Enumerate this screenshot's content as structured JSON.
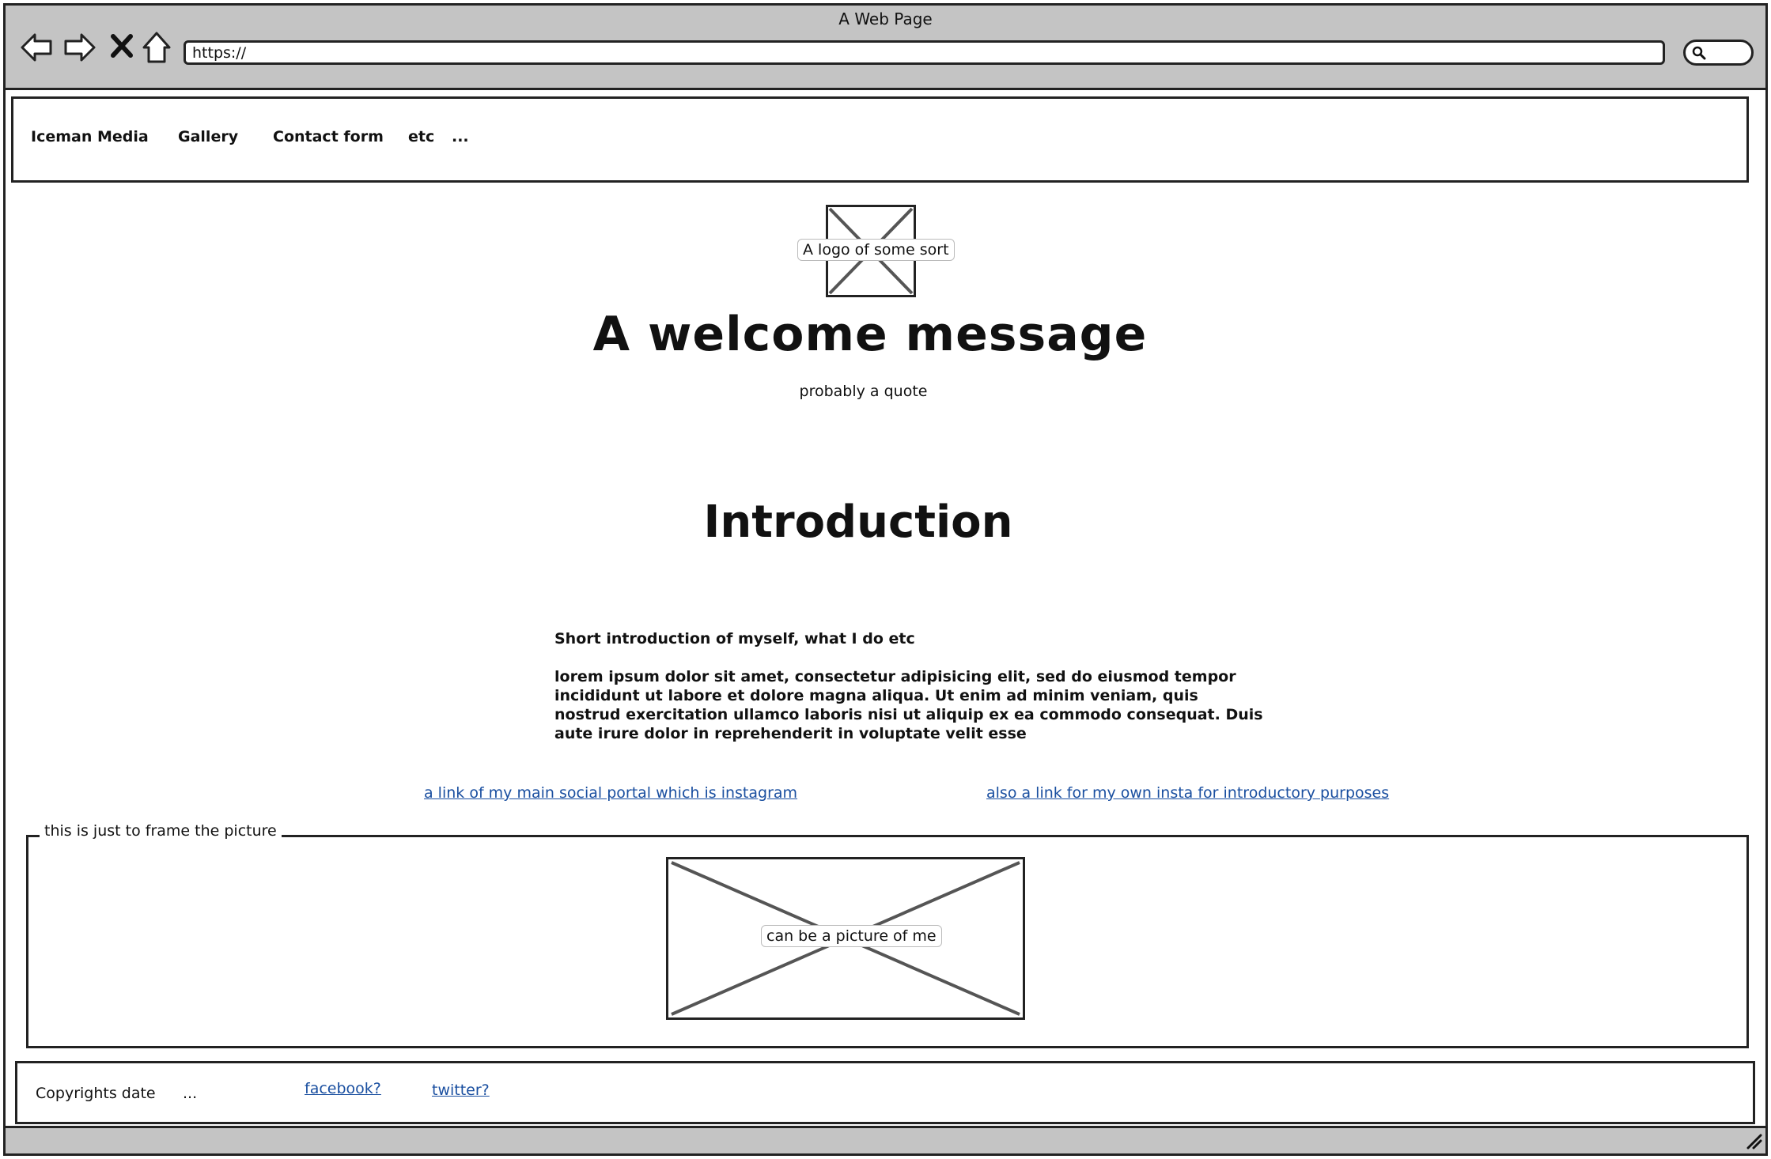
{
  "window": {
    "title": "A Web Page"
  },
  "toolbar": {
    "back_icon": "back-arrow-icon",
    "forward_icon": "forward-arrow-icon",
    "stop_icon": "close-icon",
    "home_icon": "home-icon",
    "url_value": "https://",
    "search_icon": "search-icon"
  },
  "nav": {
    "items": [
      {
        "label": "Iceman Media"
      },
      {
        "label": "Gallery"
      },
      {
        "label": "Contact form"
      },
      {
        "label": "etc"
      },
      {
        "label": "..."
      }
    ]
  },
  "hero": {
    "logo_label": "A logo of some sort",
    "welcome": "A welcome message",
    "quote": "probably a quote"
  },
  "intro": {
    "heading": "Introduction",
    "subheading": "Short introduction of myself, what I do etc",
    "body": "lorem ipsum dolor sit amet, consectetur adipisicing elit, sed do eiusmod tempor incididunt ut labore et dolore magna aliqua. Ut enim ad minim veniam, quis nostrud exercitation ullamco laboris nisi ut aliquip ex ea commodo consequat. Duis aute irure dolor in reprehenderit in voluptate velit esse"
  },
  "links": {
    "instagram_main": "a link of my main social portal which is instagram",
    "instagram_own": "also a link for my own insta for introductory purposes"
  },
  "picture_frame": {
    "legend": "this is just to frame the picture",
    "picture_label": "can be a picture of me"
  },
  "footer": {
    "copyright": "Copyrights  date",
    "ellipsis": "...",
    "facebook": "facebook?",
    "twitter": "twitter?"
  },
  "colors": {
    "chrome_gray": "#c4c4c4",
    "link_blue": "#1a4fa0",
    "placeholder_x": "#555555"
  }
}
